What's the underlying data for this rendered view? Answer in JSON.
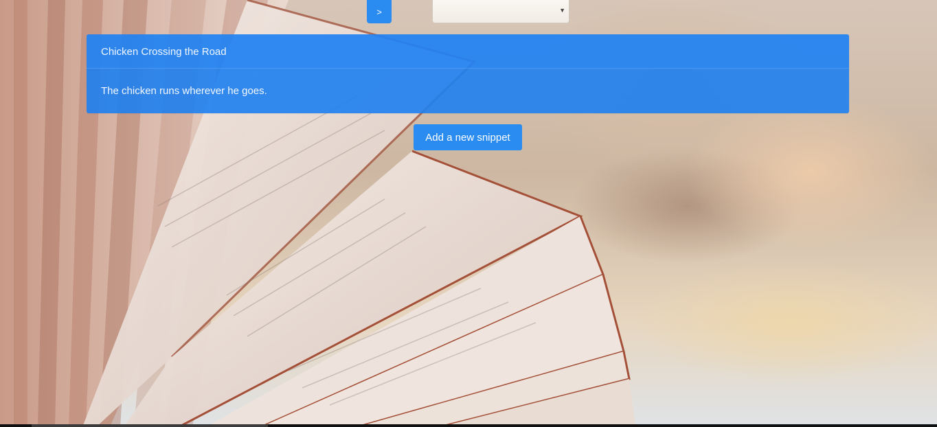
{
  "nav": {
    "next_label": ">",
    "select_value": ""
  },
  "snippet": {
    "title": "Chicken Crossing the Road",
    "body": "The chicken runs wherever he goes."
  },
  "actions": {
    "add_label": "Add a new snippet"
  },
  "colors": {
    "accent": "#2a8cf0",
    "panel": "#1e80f0",
    "text_on_accent": "#ffffff"
  },
  "background": {
    "image": "open-book-photo"
  }
}
